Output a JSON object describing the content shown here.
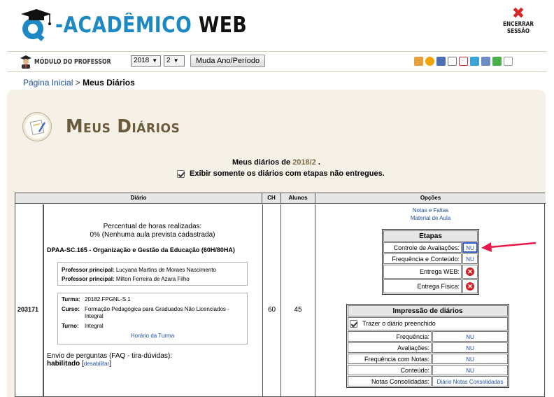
{
  "header": {
    "logo_text_prefix": "-ACADÊMICO",
    "logo_text_suffix": "WEB",
    "logout_line1": "ENCERRAR",
    "logout_line2": "SESSÃO"
  },
  "toolbar": {
    "module_label": "MÓDULO DO PROFESSOR",
    "year_value": "2018",
    "period_value": "2",
    "change_button": "Muda Ano/Período",
    "icons": [
      "lock-icon",
      "clock-icon",
      "pen-icon",
      "document-icon",
      "calendar-icon",
      "grid-icon",
      "tools-icon",
      "chart-icon",
      "notes-icon"
    ]
  },
  "breadcrumb": {
    "home": "Página Inicial",
    "separator": ">",
    "current": "Meus Diários"
  },
  "page": {
    "title": "Meus Diários",
    "diarios_prefix": "Meus diários de",
    "diarios_period": "2018/2",
    "diarios_suffix": ".",
    "filter_label": "Exibir somente os diários com etapas não entregues."
  },
  "table": {
    "headers": {
      "diario": "Diário",
      "ch": "CH",
      "alunos": "Alunos",
      "opcoes": "Opções"
    },
    "row": {
      "code": "203171",
      "perc_line1": "Percentual de horas realizadas:",
      "perc_line2": "0% (Nenhuma aula prevista cadastrada)",
      "discipline": "DPAA-SC.165 - Organização e Gestão da Educação (60H/80HA)",
      "prof1_key": "Professor principal:",
      "prof1_val": "Lucyana Martins de Moraes Nascimento",
      "prof2_key": "Professor principal:",
      "prof2_val": "Milton Ferreira de Azara Filho",
      "turma_key": "Turma:",
      "turma_val": "20182.FPGNL-S.1",
      "curso_key": "Curso:",
      "curso_val": "Formação Pedagógica para Graduados Não Licenciados - Integral",
      "turno_key": "Turno:",
      "turno_val": "Integral",
      "horario_link": "Horário da Turma",
      "faq_line": "Envio de perguntas (FAQ - tira-dúvidas):",
      "faq_status": "habilitado",
      "faq_open": "[",
      "faq_link": "desabilitar",
      "faq_close": "]",
      "ch": "60",
      "alunos": "45"
    },
    "options": {
      "link1": "Notas e Faltas",
      "link2": "Material de Aula",
      "etapas_title": "Etapas",
      "etapas": [
        {
          "label": "Controle de Avaliações:",
          "value": "NU"
        },
        {
          "label": "Frequência e Conteúdo:",
          "value": "NU"
        },
        {
          "label": "Entrega WEB:",
          "value": ""
        },
        {
          "label": "Entrega Física:",
          "value": ""
        }
      ],
      "impressao_title": "Impressão de diários",
      "trazer_label": "Trazer o diário preenchido",
      "impressao": [
        {
          "label": "Frequência:",
          "value": "NU"
        },
        {
          "label": "Avaliações:",
          "value": "NU"
        },
        {
          "label": "Frequência com Notas:",
          "value": "NU"
        },
        {
          "label": "Conteúdo:",
          "value": "NU"
        },
        {
          "label": "Notas Consolidadas:",
          "value": "Diário Notas Consolidadas"
        }
      ]
    }
  },
  "colors": {
    "accent_blue": "#1c89c4",
    "title_brown": "#6b5a3c",
    "panel_bg": "#f6f1e7",
    "arrow_red": "#e8174a",
    "delete_red": "#d02328"
  }
}
